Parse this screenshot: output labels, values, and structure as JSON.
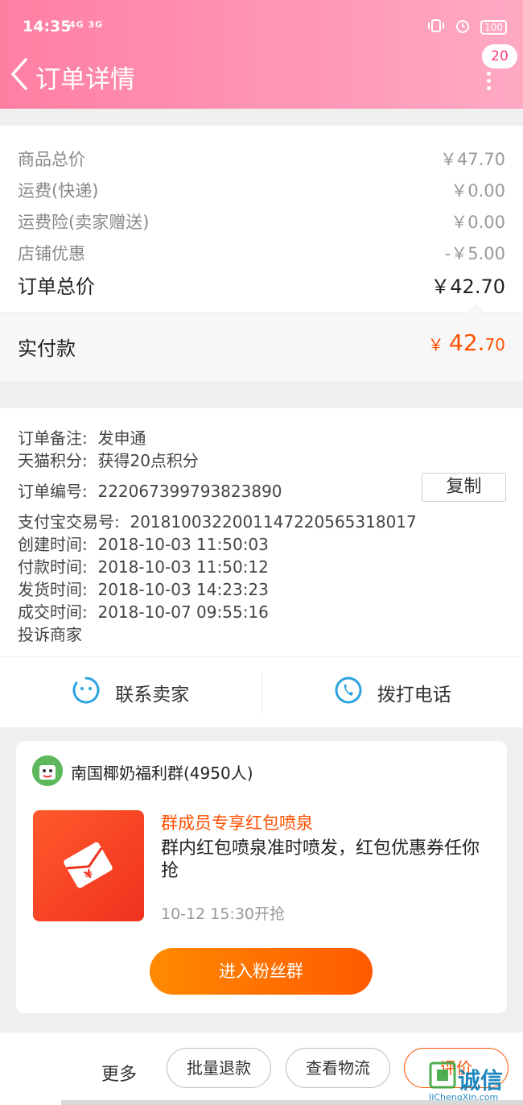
{
  "status_bar": {
    "time": "14:35",
    "network": "4G 3G",
    "battery": "100"
  },
  "header": {
    "title": "订单详情",
    "message_badge": "20"
  },
  "price_section": {
    "rows": [
      {
        "label": "商品总价",
        "value": "￥47.70"
      },
      {
        "label": "运费(快递)",
        "value": "￥0.00"
      },
      {
        "label": "运费险(卖家赠送)",
        "value": "￥0.00"
      },
      {
        "label": "店铺优惠",
        "value": "-￥5.00"
      }
    ],
    "total_label": "订单总价",
    "total_value": "￥42.70",
    "paid_label": "实付款",
    "paid_currency": "￥",
    "paid_int": "42.",
    "paid_dec": "70"
  },
  "info_section": {
    "remark_label": "订单备注:",
    "remark_value": "发申通",
    "points_label": "天猫积分:",
    "points_value": "获得20点积分",
    "order_no_label": "订单编号:",
    "order_no_value": "2220673997938238 90",
    "copy_label": "复制",
    "alipay_label": "支付宝交易号:",
    "alipay_value": "2018100322001147220565318017",
    "created_label": "创建时间:",
    "created_value": "2018-10-03 11:50:03",
    "paid_time_label": "付款时间:",
    "paid_time_value": "2018-10-03 11:50:12",
    "shipped_label": "发货时间:",
    "shipped_value": "2018-10-03 14:23:23",
    "closed_label": "成交时间:",
    "closed_value": "2018-10-07 09:55:16",
    "complain_label": "投诉商家"
  },
  "contact": {
    "contact_seller": "联系卖家",
    "call_phone": "拨打电话"
  },
  "group_card": {
    "group_name": "南国椰奶福利群(4950人)",
    "promo_title": "群成员专享红包喷泉",
    "promo_desc": "群内红包喷泉准时喷发，红包优惠券任你抢",
    "promo_time": "10-12 15:30开抢",
    "join_button": "进入粉丝群"
  },
  "bottom_bar": {
    "more": "更多",
    "batch_refund": "批量退款",
    "view_logistics": "查看物流",
    "rate": "评价"
  },
  "watermark": {
    "text": "诚信",
    "url": "JiChengXin.com"
  },
  "colors": {
    "header_pink": "#ff8fae",
    "accent_orange": "#ff5000",
    "icon_blue": "#2aa3e0"
  }
}
